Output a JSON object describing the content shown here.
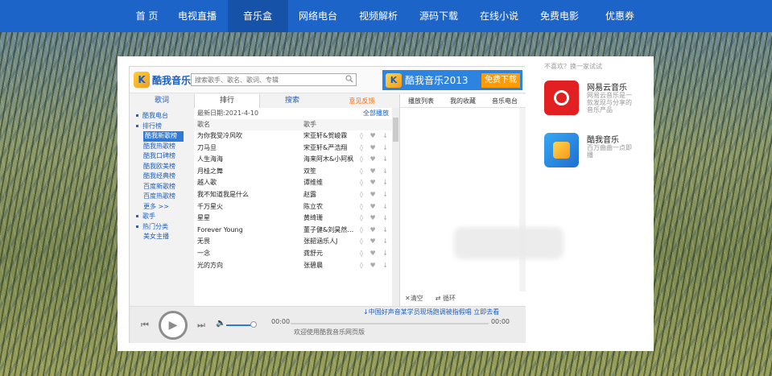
{
  "nav": {
    "items": [
      "首 页",
      "电视直播",
      "音乐盒",
      "网络电台",
      "视频解析",
      "源码下载",
      "在线小说",
      "免费电影",
      "优惠券"
    ],
    "active_index": 2
  },
  "player": {
    "logo_text": "酷我音乐",
    "logo_mark": "K",
    "search_placeholder": "搜索歌手、歌名、歌词、专辑",
    "banner_title": "酷我音乐2013",
    "banner_download": "免费下载",
    "tabs": [
      "歌词",
      "排行",
      "搜索",
      "意见反馈"
    ],
    "active_tab": 1,
    "sidebar": [
      {
        "label": "酷我电台",
        "type": "group"
      },
      {
        "label": "排行榜",
        "type": "group-open"
      },
      {
        "label": "酷我新歌榜",
        "type": "selected"
      },
      {
        "label": "酷我热歌榜",
        "type": "sub"
      },
      {
        "label": "酷我口碑榜",
        "type": "sub"
      },
      {
        "label": "酷我欧美榜",
        "type": "sub"
      },
      {
        "label": "酷我经典榜",
        "type": "sub"
      },
      {
        "label": "百度新歌榜",
        "type": "sub"
      },
      {
        "label": "百度热歌榜",
        "type": "sub"
      },
      {
        "label": "更多 >>",
        "type": "sub"
      },
      {
        "label": "歌手",
        "type": "group"
      },
      {
        "label": "热门分类",
        "type": "group"
      },
      {
        "label": "美女主播",
        "type": "sub"
      }
    ],
    "list": {
      "date_label": "最新日期:2021-4-10",
      "play_all": "全部播放",
      "col_song": "歌名",
      "col_singer": "歌手",
      "rows": [
        {
          "song": "为你我受冷风吹",
          "singer": "宋亚轩&贺峻霖"
        },
        {
          "song": "刀马旦",
          "singer": "宋亚轩&严浩翔"
        },
        {
          "song": "人生海海",
          "singer": "海来阿木&小阿枫"
        },
        {
          "song": "月桂之舞",
          "singer": "双笙"
        },
        {
          "song": "越人歌",
          "singer": "谭维维"
        },
        {
          "song": "我不知道我是什么",
          "singer": "赵露"
        },
        {
          "song": "千万星火",
          "singer": "陈立农"
        },
        {
          "song": "星星",
          "singer": "黄绮珊"
        },
        {
          "song": "Forever Young",
          "singer": "董子健&刘昊然…"
        },
        {
          "song": "无畏",
          "singer": "张韶涵乐人J"
        },
        {
          "song": "一念",
          "singer": "龚舒元"
        },
        {
          "song": "光的方向",
          "singer": "张碧晨"
        }
      ],
      "row_actions": "◊ ♥ ↓"
    },
    "right_tabs": [
      "播放列表",
      "我的收藏",
      "音乐电台"
    ],
    "right_bar": {
      "clear": "✕清空",
      "loop": "⇄ 循环"
    },
    "ticker": "中国好声音某学员现场跑调被指假唱 立即去看",
    "time_start": "00:00",
    "time_end": "00:00",
    "welcome": "欢迎使用酷我音乐网页版"
  },
  "aside": {
    "hint": "不喜欢？换一家试试",
    "apps": [
      {
        "name": "网易云音乐",
        "desc": "网易云音乐是一款发现与分享的音乐产品",
        "icon": "netease-music-icon"
      },
      {
        "name": "酷我音乐",
        "desc": "百万曲曲一点即播",
        "icon": "kuwo-music-icon"
      }
    ]
  },
  "colors": {
    "nav": "#1d64c8",
    "accent": "#1e5fbf",
    "orange": "#ff9b00"
  }
}
